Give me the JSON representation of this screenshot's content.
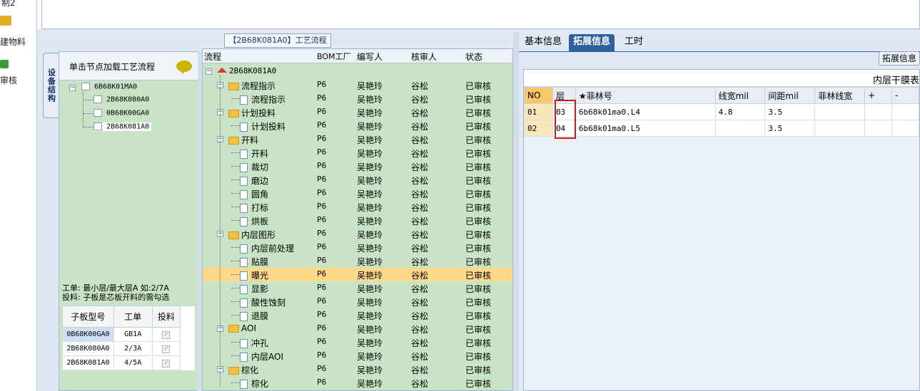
{
  "left_strip": {
    "item1": "制2",
    "item2": "建物料",
    "item3": "审核"
  },
  "side_tab": "设备结构",
  "panel_a": {
    "hint": "单击节点加载工艺流程",
    "tree_root": "6B68K01MA0",
    "tree_children": [
      "2B68K080A0",
      "0B68K00GA0",
      "2B68K081A0"
    ],
    "note_line1": "工单: 最小层/最大层A 如:2/7A",
    "note_line2": "投料: 子板是芯板开料的需勾选",
    "sub_table": {
      "headers": [
        "子板型号",
        "工单",
        "投料"
      ],
      "rows": [
        {
          "model": "0B68K00GA0",
          "order": "GB1A",
          "feed": "✓"
        },
        {
          "model": "2B68K080A0",
          "order": "2/3A",
          "feed": "✓"
        },
        {
          "model": "2B68K081A0",
          "order": "4/5A",
          "feed": "✓"
        }
      ]
    }
  },
  "flow_title": "【2B68K081A0】工艺流程",
  "flow": {
    "headers": [
      "流程",
      "BOM工厂",
      "编写人",
      "核审人",
      "状态"
    ],
    "root": "2B68K081A0",
    "rows": [
      {
        "name": "流程指示",
        "factory": "P6",
        "writer": "吴艳玲",
        "reviewer": "谷松",
        "status": "已审核",
        "level": 1
      },
      {
        "name": "流程指示",
        "factory": "P6",
        "writer": "吴艳玲",
        "reviewer": "谷松",
        "status": "已审核",
        "level": 2
      },
      {
        "name": "计划投料",
        "factory": "P6",
        "writer": "吴艳玲",
        "reviewer": "谷松",
        "status": "已审核",
        "level": 1
      },
      {
        "name": "计划投料",
        "factory": "P6",
        "writer": "吴艳玲",
        "reviewer": "谷松",
        "status": "已审核",
        "level": 2
      },
      {
        "name": "开料",
        "factory": "P6",
        "writer": "吴艳玲",
        "reviewer": "谷松",
        "status": "已审核",
        "level": 1
      },
      {
        "name": "开料",
        "factory": "P6",
        "writer": "吴艳玲",
        "reviewer": "谷松",
        "status": "已审核",
        "level": 2
      },
      {
        "name": "裁切",
        "factory": "P6",
        "writer": "吴艳玲",
        "reviewer": "谷松",
        "status": "已审核",
        "level": 2
      },
      {
        "name": "磨边",
        "factory": "P6",
        "writer": "吴艳玲",
        "reviewer": "谷松",
        "status": "已审核",
        "level": 2
      },
      {
        "name": "圆角",
        "factory": "P6",
        "writer": "吴艳玲",
        "reviewer": "谷松",
        "status": "已审核",
        "level": 2
      },
      {
        "name": "打标",
        "factory": "P6",
        "writer": "吴艳玲",
        "reviewer": "谷松",
        "status": "已审核",
        "level": 2
      },
      {
        "name": "烘板",
        "factory": "P6",
        "writer": "吴艳玲",
        "reviewer": "谷松",
        "status": "已审核",
        "level": 2
      },
      {
        "name": "内层图形",
        "factory": "P6",
        "writer": "吴艳玲",
        "reviewer": "谷松",
        "status": "已审核",
        "level": 1
      },
      {
        "name": "内层前处理",
        "factory": "P6",
        "writer": "吴艳玲",
        "reviewer": "谷松",
        "status": "已审核",
        "level": 2
      },
      {
        "name": "贴膜",
        "factory": "P6",
        "writer": "吴艳玲",
        "reviewer": "谷松",
        "status": "已审核",
        "level": 2
      },
      {
        "name": "曝光",
        "factory": "P6",
        "writer": "吴艳玲",
        "reviewer": "谷松",
        "status": "已审核",
        "level": 2,
        "selected": true
      },
      {
        "name": "显影",
        "factory": "P6",
        "writer": "吴艳玲",
        "reviewer": "谷松",
        "status": "已审核",
        "level": 2
      },
      {
        "name": "酸性蚀刻",
        "factory": "P6",
        "writer": "吴艳玲",
        "reviewer": "谷松",
        "status": "已审核",
        "level": 2
      },
      {
        "name": "退膜",
        "factory": "P6",
        "writer": "吴艳玲",
        "reviewer": "谷松",
        "status": "已审核",
        "level": 2
      },
      {
        "name": "AOI",
        "factory": "P6",
        "writer": "吴艳玲",
        "reviewer": "谷松",
        "status": "已审核",
        "level": 1
      },
      {
        "name": "冲孔",
        "factory": "P6",
        "writer": "吴艳玲",
        "reviewer": "谷松",
        "status": "已审核",
        "level": 2
      },
      {
        "name": "内层AOI",
        "factory": "P6",
        "writer": "吴艳玲",
        "reviewer": "谷松",
        "status": "已审核",
        "level": 2
      },
      {
        "name": "棕化",
        "factory": "P6",
        "writer": "吴艳玲",
        "reviewer": "谷松",
        "status": "已审核",
        "level": 1
      },
      {
        "name": "棕化",
        "factory": "P6",
        "writer": "吴艳玲",
        "reviewer": "谷松",
        "status": "已审核",
        "level": 2
      }
    ]
  },
  "right": {
    "tabs": [
      "基本信息",
      "拓展信息",
      "工时"
    ],
    "active_tab": 1,
    "button": "拓展信息",
    "grid_title": "内层干膜表",
    "headers": [
      "NO",
      "层",
      "★菲林号",
      "线宽mil",
      "间距mil",
      "菲林线宽",
      "+",
      "-"
    ],
    "rows": [
      {
        "no": "01",
        "layer": "03",
        "film": "6b68k01ma0.L4",
        "width": "4.8",
        "space": "3.5",
        "filmwidth": "",
        "plus": "",
        "minus": ""
      },
      {
        "no": "02",
        "layer": "04",
        "film": "6b68k01ma0.L5",
        "width": "",
        "space": "3.5",
        "filmwidth": "",
        "plus": "",
        "minus": ""
      }
    ]
  }
}
